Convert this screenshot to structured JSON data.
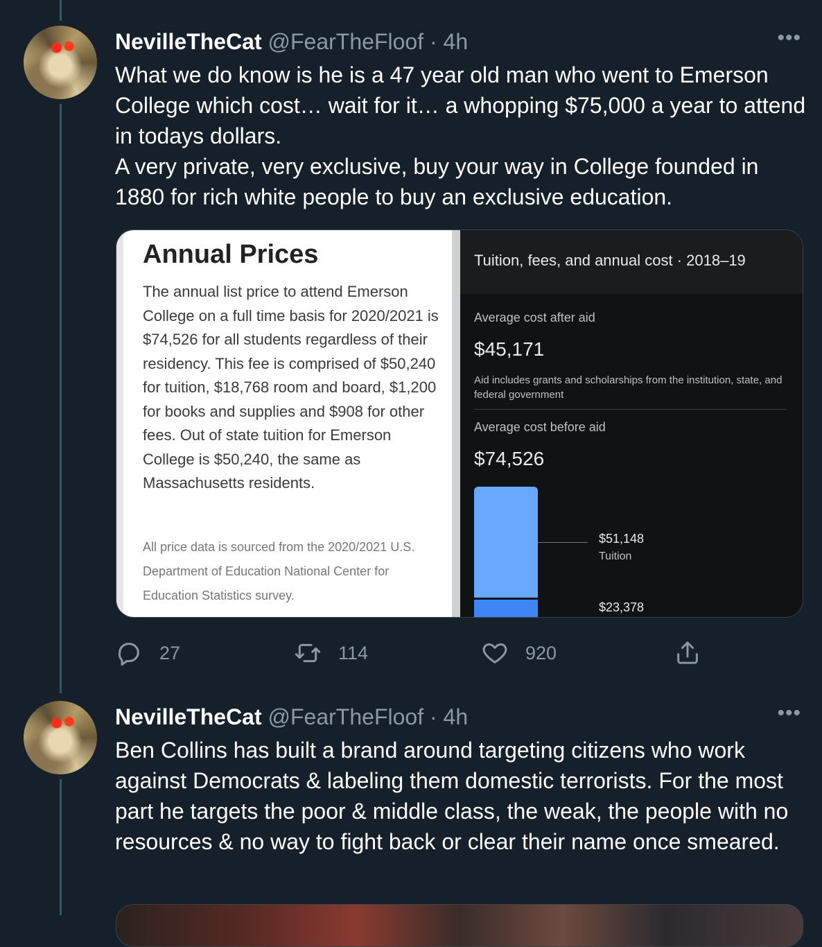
{
  "tweets": [
    {
      "display_name": "NevilleTheCat",
      "handle": "@FearTheFloof",
      "time": "· 4h",
      "text": [
        "What we do know is he is a 47 year old man who went to Emerson College which cost… wait for it… a whopping $75,000 a year to attend in todays dollars.",
        "A very private, very exclusive, buy your way in College founded in 1880 for rich white people to buy an exclusive education."
      ],
      "media": {
        "left": {
          "title": "Annual Prices",
          "body": "The annual list price to attend Emerson College on a full time basis for 2020/2021 is $74,526 for all students regardless of their residency. This fee is comprised of $50,240 for tuition, $18,768 room and board, $1,200 for books and supplies and $908 for other fees. Out of state tuition for Emerson College is $50,240, the same as Massachusetts residents.",
          "source": "All price data is sourced from the 2020/2021 U.S. Department of Education National Center for Education Statistics survey."
        },
        "right": {
          "heading": "Tuition, fees, and annual cost · 2018–19",
          "after_aid_label": "Average cost after aid",
          "after_aid_value": "$45,171",
          "aid_note": "Aid includes grants and scholarships from the institution, state, and federal government",
          "before_aid_label": "Average cost before aid",
          "before_aid_value": "$74,526",
          "tuition_value": "$51,148",
          "tuition_label": "Tuition",
          "second_value": "$23,378"
        }
      },
      "stats": {
        "replies": "27",
        "retweets": "114",
        "likes": "920"
      }
    },
    {
      "display_name": "NevilleTheCat",
      "handle": "@FearTheFloof",
      "time": "· 4h",
      "text": "Ben Collins has built a brand around targeting citizens who work against Democrats & labeling them domestic terrorists. For the most part he targets the poor & middle class, the weak, the people with no resources & no way to fight back or clear their name once smeared."
    }
  ],
  "colors": {
    "background": "#15202b",
    "secondary_text": "#8b98a5",
    "bar_light": "#69a8ff",
    "bar_dark": "#3e86f5"
  }
}
